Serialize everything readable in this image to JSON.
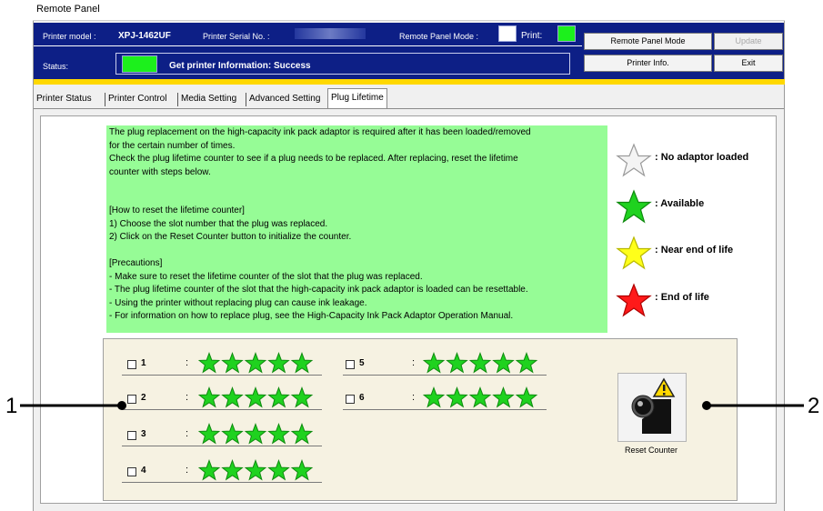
{
  "window": {
    "title": "Remote Panel"
  },
  "header": {
    "printer_model_label": "Printer model :",
    "printer_model_value": "XPJ-1462UF",
    "serial_label": "Printer Serial No. :",
    "remote_mode_label": "Remote Panel Mode :",
    "print_label": "Print:",
    "status_label": "Status:",
    "status_message": "Get printer Information: Success"
  },
  "buttons": {
    "remote_panel_mode": "Remote Panel Mode",
    "update": "Update",
    "printer_info": "Printer Info.",
    "exit": "Exit"
  },
  "tabs": [
    {
      "label": "Printer Status"
    },
    {
      "label": "Printer Control"
    },
    {
      "label": "Media Setting"
    },
    {
      "label": "Advanced Setting"
    },
    {
      "label": "Plug Lifetime"
    }
  ],
  "info_lines": [
    "The plug replacement on the high-capacity ink pack adaptor is required after it has been loaded/removed",
    "for the certain number of times.",
    "Check the plug lifetime counter to see if a plug needs to be replaced. After replacing, reset the lifetime",
    "counter with steps below.",
    "",
    "[How to reset the lifetime counter]",
    "1) Choose the slot number that the plug was replaced.",
    "2) Click on the Reset Counter button to initialize the counter.",
    "",
    "[Precautions]",
    "- Make sure to reset the lifetime counter of the slot that the plug was replaced.",
    "- The plug lifetime counter of the slot that the high-capacity ink pack adaptor is loaded can be resettable.",
    "- Using the printer without replacing plug can cause ink leakage.",
    "- For information on how to replace plug, see the High-Capacity Ink Pack Adaptor Operation Manual."
  ],
  "legend": [
    {
      "label": ": No adaptor loaded",
      "color": "#f4f4f4",
      "stroke": "#9a9a9a"
    },
    {
      "label": ": Available",
      "color": "#1fd21f",
      "stroke": "#0f8a0f"
    },
    {
      "label": ": Near end of life",
      "color": "#ffff1a",
      "stroke": "#b8b800"
    },
    {
      "label": ": End of life",
      "color": "#ff1a1a",
      "stroke": "#b00000"
    }
  ],
  "slots": [
    {
      "number": "1",
      "colon": ":",
      "checked": false,
      "stars": 5,
      "status": "available"
    },
    {
      "number": "2",
      "colon": ":",
      "checked": false,
      "stars": 5,
      "status": "available"
    },
    {
      "number": "3",
      "colon": ":",
      "checked": false,
      "stars": 5,
      "status": "available"
    },
    {
      "number": "4",
      "colon": ":",
      "checked": false,
      "stars": 5,
      "status": "available"
    },
    {
      "number": "5",
      "colon": ":",
      "checked": false,
      "stars": 5,
      "status": "available"
    },
    {
      "number": "6",
      "colon": ":",
      "checked": false,
      "stars": 5,
      "status": "available"
    }
  ],
  "reset_counter_label": "Reset Counter",
  "callouts": {
    "left": "1",
    "right": "2"
  },
  "colors": {
    "header_bg": "#0d1f86",
    "status_green": "#1cf01c",
    "info_bg": "#96fc96",
    "slot_panel_bg": "#f6f2e2",
    "star_green": "#1fd21f",
    "accent_yellow": "#ffd800"
  }
}
